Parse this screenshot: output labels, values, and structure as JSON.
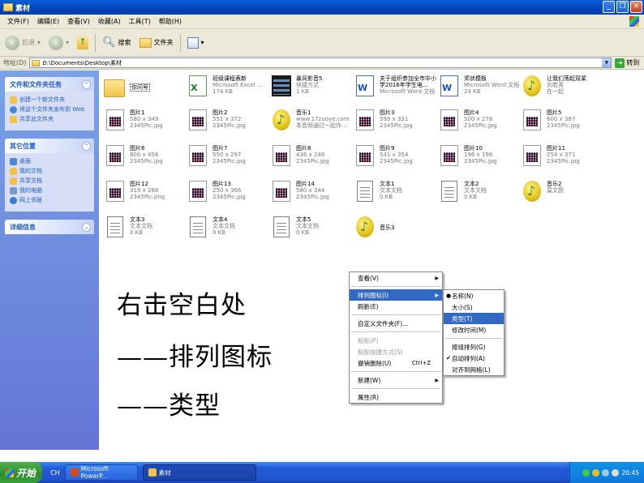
{
  "window": {
    "title": "素材"
  },
  "menu": [
    "文件(F)",
    "编辑(E)",
    "查看(V)",
    "收藏(A)",
    "工具(T)",
    "帮助(H)"
  ],
  "toolbar": {
    "back": "后退",
    "search": "搜索",
    "folders": "文件夹"
  },
  "address": {
    "label": "地址(D)",
    "path": "D:\\Documents\\Desktop\\素材",
    "go": "转到"
  },
  "tasks": {
    "file_folder": {
      "title": "文件和文件夹任务",
      "links": [
        "创建一个新文件夹",
        "将这个文件夹发布到 Web",
        "共享此文件夹"
      ]
    },
    "other": {
      "title": "其它位置",
      "links": [
        "桌面",
        "我的文档",
        "共享文档",
        "我的电脑",
        "网上邻居"
      ]
    },
    "details": {
      "title": "详细信息"
    }
  },
  "files": [
    {
      "name": "你问号",
      "sub1": "",
      "sub2": "",
      "icon": "folder"
    },
    {
      "name": "班级课程表新",
      "sub1": "Microsoft Excel ...",
      "sub2": "174 KB",
      "icon": "xls"
    },
    {
      "name": "暴风影音5",
      "sub1": "快捷方式",
      "sub2": "1 KB",
      "icon": "film"
    },
    {
      "name": "关于组织参加全市中小学2016年学生电...",
      "sub1": "Microsoft Word 文档",
      "sub2": "",
      "icon": "doc"
    },
    {
      "name": "奖状模板",
      "sub1": "Microsoft Word 文档",
      "sub2": "24 KB",
      "icon": "doc"
    },
    {
      "name": "让我们荡起双桨",
      "sub1": "刘若英",
      "sub2": "在一起",
      "icon": "music"
    },
    {
      "name": "图片1",
      "sub1": "580 x 349",
      "sub2": "2345Pic.jpg",
      "icon": "img"
    },
    {
      "name": "图片2",
      "sub1": "551 x 372",
      "sub2": "2345Pic.jpg",
      "icon": "img"
    },
    {
      "name": "音乐1",
      "sub1": "www.17zuoye.com",
      "sub2": "本音频通过一起作...",
      "icon": "music"
    },
    {
      "name": "图片3",
      "sub1": "599 x 331",
      "sub2": "2345Pic.jpg",
      "icon": "img"
    },
    {
      "name": "图片4",
      "sub1": "500 x 278",
      "sub2": "2345Pic.jpg",
      "icon": "img"
    },
    {
      "name": "图片5",
      "sub1": "600 x 387",
      "sub2": "2345Pic.jpg",
      "icon": "img"
    },
    {
      "name": "图片6",
      "sub1": "800 x 456",
      "sub2": "2345Pic.jpg",
      "icon": "img"
    },
    {
      "name": "图片7",
      "sub1": "550 x 297",
      "sub2": "2345Pic.jpg",
      "icon": "img"
    },
    {
      "name": "图片8",
      "sub1": "436 x 246",
      "sub2": "2345Pic.jpg",
      "icon": "img"
    },
    {
      "name": "图片9",
      "sub1": "541 x 354",
      "sub2": "2345Pic.jpg",
      "icon": "img"
    },
    {
      "name": "图片10",
      "sub1": "196 x 196",
      "sub2": "2345Pic.jpg",
      "icon": "img"
    },
    {
      "name": "图片11",
      "sub1": "254 x 371",
      "sub2": "2345Pic.jpg",
      "icon": "img"
    },
    {
      "name": "图片12",
      "sub1": "319 x 288",
      "sub2": "2345Pic.png",
      "icon": "img"
    },
    {
      "name": "图片13",
      "sub1": "250 x 366",
      "sub2": "2345Pic.jpg",
      "icon": "img"
    },
    {
      "name": "图片14",
      "sub1": "580 x 344",
      "sub2": "2345Pic.jpg",
      "icon": "img"
    },
    {
      "name": "文本1",
      "sub1": "文本文档",
      "sub2": "0 KB",
      "icon": "txt"
    },
    {
      "name": "文本2",
      "sub1": "文本文档",
      "sub2": "0 KB",
      "icon": "txt"
    },
    {
      "name": "音乐2",
      "sub1": "莫文蔚",
      "sub2": "",
      "icon": "music"
    },
    {
      "name": "文本3",
      "sub1": "文本文档",
      "sub2": "0 KB",
      "icon": "txt"
    },
    {
      "name": "文本4",
      "sub1": "文本文档",
      "sub2": "0 KB",
      "icon": "txt"
    },
    {
      "name": "文本5",
      "sub1": "文本文档",
      "sub2": "0 KB",
      "icon": "txt"
    },
    {
      "name": "音乐3",
      "sub1": "",
      "sub2": "",
      "icon": "music"
    }
  ],
  "overlay": {
    "line1": "右击空白处",
    "line2": "——排列图标",
    "line3": "——类型"
  },
  "context_menu": {
    "view": "查看(V)",
    "arrange": "排列图标(I)",
    "refresh": "刷新(E)",
    "customize": "自定义文件夹(F)...",
    "paste": "粘贴(P)",
    "paste_shortcut": "粘贴快捷方式(S)",
    "undo_delete": "撤销删除(U)",
    "undo_shortcut": "Ctrl+Z",
    "new": "新建(W)",
    "properties": "属性(R)"
  },
  "submenu": {
    "name": "名称(N)",
    "size": "大小(S)",
    "type": "类型(T)",
    "modified": "修改时间(M)",
    "group": "按组排列(G)",
    "auto": "自动排列(A)",
    "grid": "对齐到网格(L)"
  },
  "taskbar": {
    "start": "开始",
    "lang": "CH",
    "items": [
      "Microsoft PowerP...",
      "素材"
    ],
    "clock": "20:45"
  },
  "colors": {
    "title_bar": "#0a5fd8",
    "left_panel": "#7ba2e7",
    "highlight": "#316ac5",
    "taskbar": "#2459d6",
    "start": "#3aa23a"
  }
}
